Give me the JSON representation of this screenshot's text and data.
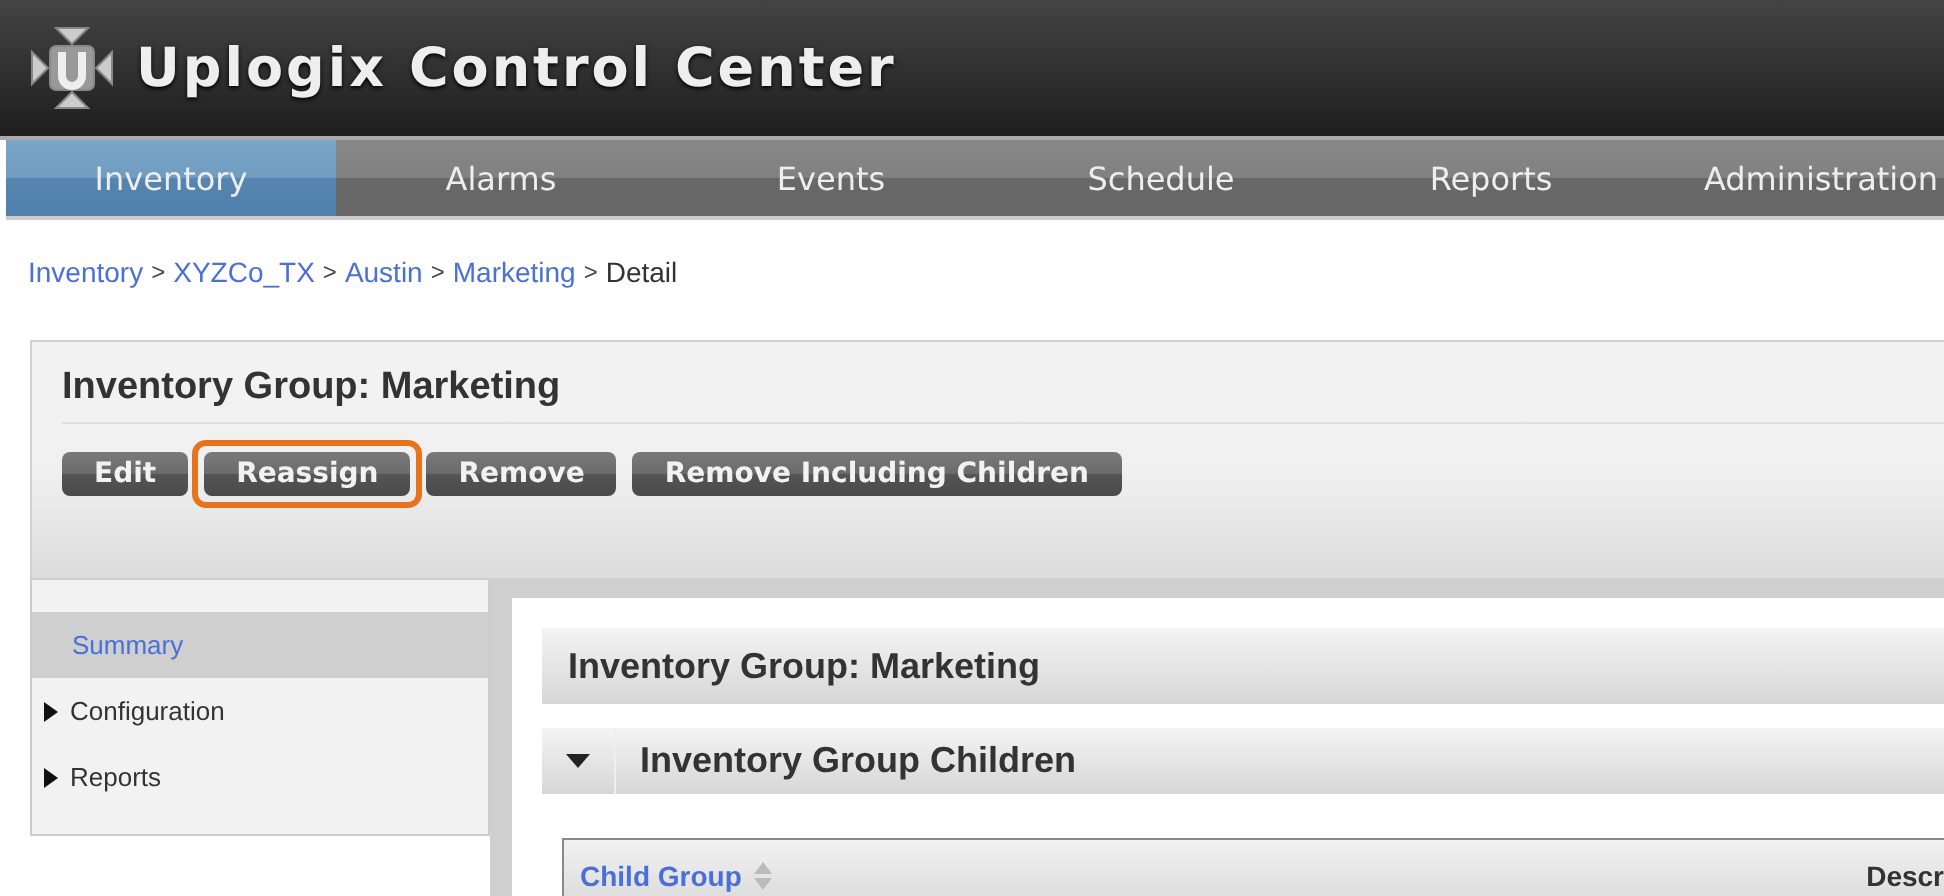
{
  "app": {
    "title": "Uplogix Control Center"
  },
  "nav": [
    {
      "label": "Inventory",
      "selected": true
    },
    {
      "label": "Alarms",
      "selected": false
    },
    {
      "label": "Events",
      "selected": false
    },
    {
      "label": "Schedule",
      "selected": false
    },
    {
      "label": "Reports",
      "selected": false
    },
    {
      "label": "Administration",
      "selected": false
    }
  ],
  "breadcrumb": [
    {
      "kind": "link",
      "text": "Inventory"
    },
    {
      "kind": "sep",
      "text": ">"
    },
    {
      "kind": "link",
      "text": "XYZCo_TX"
    },
    {
      "kind": "sep",
      "text": ">"
    },
    {
      "kind": "link",
      "text": "Austin"
    },
    {
      "kind": "sep",
      "text": ">"
    },
    {
      "kind": "link",
      "text": "Marketing"
    },
    {
      "kind": "sep",
      "text": ">"
    },
    {
      "kind": "current",
      "text": "Detail"
    }
  ],
  "page": {
    "title": "Inventory Group: Marketing"
  },
  "actions": [
    {
      "label": "Edit",
      "highlighted": false
    },
    {
      "label": "Reassign",
      "highlighted": true
    },
    {
      "label": "Remove",
      "highlighted": false
    },
    {
      "label": "Remove Including Children",
      "highlighted": false
    }
  ],
  "sidebar": {
    "items": [
      {
        "label": "Summary",
        "kind": "link",
        "selected": true
      },
      {
        "label": "Configuration",
        "kind": "expandable",
        "selected": false
      },
      {
        "label": "Reports",
        "kind": "expandable",
        "selected": false
      }
    ]
  },
  "content": {
    "title": "Inventory Group: Marketing",
    "section": {
      "title": "Inventory Group Children",
      "expanded": true
    },
    "table": {
      "columns": [
        {
          "label": "Child Group",
          "sortable": true
        },
        {
          "label": "Descr",
          "sortable": false
        }
      ]
    }
  }
}
